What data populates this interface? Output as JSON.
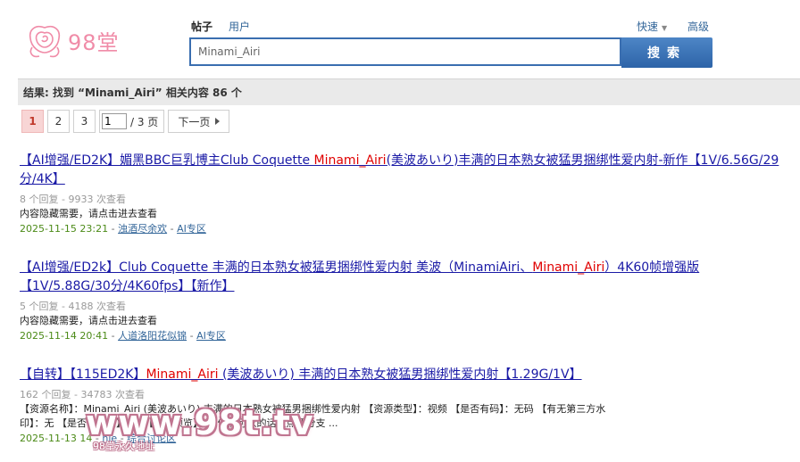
{
  "header": {
    "logo_text": "98堂",
    "tabs": [
      {
        "label": "帖子",
        "active": true
      },
      {
        "label": "用户",
        "active": false
      }
    ],
    "quick_label": "快速",
    "advanced_label": "高级",
    "search_value": "Minami_Airi",
    "search_button": "搜索"
  },
  "result_summary": "结果: 找到 “Minami_Airi” 相关内容 86 个",
  "pager": {
    "pages": [
      "1",
      "2",
      "3"
    ],
    "current": "1",
    "input_value": "1",
    "total_label": "/ 3 页",
    "next_label": "下一页"
  },
  "results": [
    {
      "title_parts": [
        "【AI增强/ED2K】媚黑BBC巨乳博主Club Coquette ",
        "Minami_Airi",
        "(美波あいり)丰满的日本熟女被猛男捆绑性爱内射-新作【1V/6.56G/29分/4K】"
      ],
      "meta": "8 个回复 - 9933 次查看",
      "desc_parts": [
        "内容隐藏需要，请点击进去查看"
      ],
      "date": "2025-11-15 23:21",
      "author": "浊酒尽余欢",
      "forum": "AI专区"
    },
    {
      "title_parts": [
        "【AI增强/ED2k】Club Coquette 丰满的日本熟女被猛男捆绑性爱内射 美波（MinamiAiri、",
        "Minami_Airi",
        "）4K60帧增强版【1V/5.88G/30分/4K60fps】【新作】"
      ],
      "meta": "5 个回复 - 4188 次查看",
      "desc_parts": [
        "内容隐藏需要，请点击进去查看"
      ],
      "date": "2025-11-14 20:41",
      "author": "人道洛阳花似锦",
      "forum": "AI专区"
    },
    {
      "title_parts": [
        "【自转】【115ED2K】",
        "Minami_Airi",
        " (美波あいり) 丰满的日本熟女被猛男捆绑性爱内射【1.29G/1V】"
      ],
      "meta": "162 个回复 - 34783 次查看",
      "desc_line1": "【资源名称】：Minami_Airi (美波あいり) 丰满的日本熟女被猛男捆绑性爱内射 【资源类型】：视频 【是否有码】：无码 【有无第三方水",
      "desc_line2": "印】：无 【是否有预览】：有 【资源预览】：大佬们可以的话点点评分支 ...",
      "date": "2025-11-13 14",
      "author": "nie",
      "forum": "综合讨论区"
    }
  ],
  "watermark": {
    "main": "www.98t.tv",
    "sub": "98堂永久地址"
  },
  "colors": {
    "link": "#1a1aa6",
    "highlight": "#e00000",
    "date": "#4b8a17",
    "search_border": "#3a6eb0",
    "logo": "#f08ca8"
  }
}
